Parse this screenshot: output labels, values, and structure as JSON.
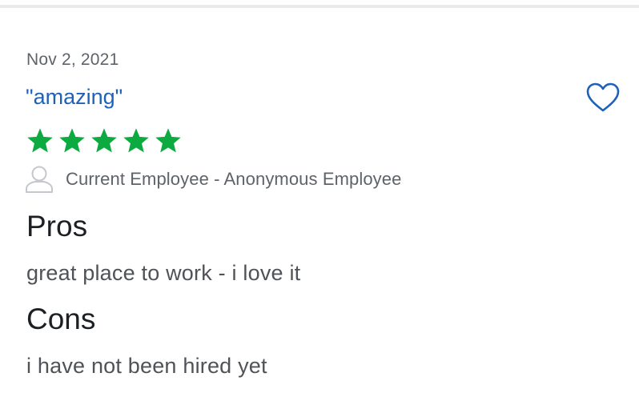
{
  "review": {
    "date": "Nov 2, 2021",
    "title": "\"amazing\"",
    "rating": 5,
    "rating_max": 5,
    "author": "Current Employee - Anonymous Employee",
    "pros_heading": "Pros",
    "pros_text": "great place to work - i love it",
    "cons_heading": "Cons",
    "cons_text": "i have not been hired yet"
  },
  "icons": {
    "favorite": "heart-outline-icon",
    "author": "person-outline-icon",
    "star": "star-icon"
  },
  "colors": {
    "title_link": "#1f61b8",
    "star_fill": "#0caa41",
    "heart_stroke": "#1f61b8",
    "text_primary": "#1c1f23",
    "text_secondary": "#5e6369"
  }
}
